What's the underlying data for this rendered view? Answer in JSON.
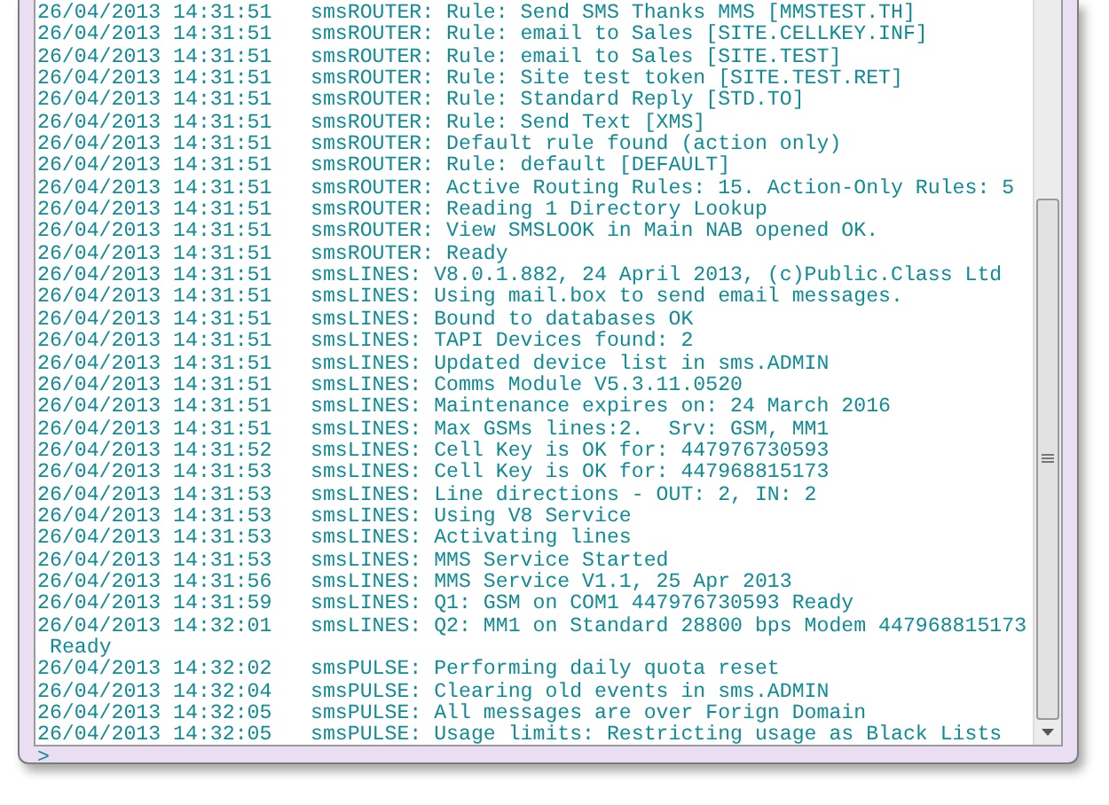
{
  "log": {
    "rows": [
      {
        "time": "26/04/2013 14:31:51",
        "message": "smsROUTER: Rule: Send SMS Thanks MMS [MMSTEST.TH]"
      },
      {
        "time": "26/04/2013 14:31:51",
        "message": "smsROUTER: Rule: email to Sales [SITE.CELLKEY.INF]"
      },
      {
        "time": "26/04/2013 14:31:51",
        "message": "smsROUTER: Rule: email to Sales [SITE.TEST]"
      },
      {
        "time": "26/04/2013 14:31:51",
        "message": "smsROUTER: Rule: Site test token [SITE.TEST.RET]"
      },
      {
        "time": "26/04/2013 14:31:51",
        "message": "smsROUTER: Rule: Standard Reply [STD.TO]"
      },
      {
        "time": "26/04/2013 14:31:51",
        "message": "smsROUTER: Rule: Send Text [XMS]"
      },
      {
        "time": "26/04/2013 14:31:51",
        "message": "smsROUTER: Default rule found (action only)"
      },
      {
        "time": "26/04/2013 14:31:51",
        "message": "smsROUTER: Rule: default [DEFAULT]"
      },
      {
        "time": "26/04/2013 14:31:51",
        "message": "smsROUTER: Active Routing Rules: 15. Action-Only Rules: 5"
      },
      {
        "time": "26/04/2013 14:31:51",
        "message": "smsROUTER: Reading 1 Directory Lookup"
      },
      {
        "time": "26/04/2013 14:31:51",
        "message": "smsROUTER: View SMSLOOK in Main NAB opened OK."
      },
      {
        "time": "26/04/2013 14:31:51",
        "message": "smsROUTER: Ready"
      },
      {
        "time": "26/04/2013 14:31:51",
        "message": "smsLINES: V8.0.1.882, 24 April 2013, (c)Public.Class Ltd"
      },
      {
        "time": "26/04/2013 14:31:51",
        "message": "smsLINES: Using mail.box to send email messages."
      },
      {
        "time": "26/04/2013 14:31:51",
        "message": "smsLINES: Bound to databases OK"
      },
      {
        "time": "26/04/2013 14:31:51",
        "message": "smsLINES: TAPI Devices found: 2"
      },
      {
        "time": "26/04/2013 14:31:51",
        "message": "smsLINES: Updated device list in sms.ADMIN"
      },
      {
        "time": "26/04/2013 14:31:51",
        "message": "smsLINES: Comms Module V5.3.11.0520"
      },
      {
        "time": "26/04/2013 14:31:51",
        "message": "smsLINES: Maintenance expires on: 24 March 2016"
      },
      {
        "time": "26/04/2013 14:31:51",
        "message": "smsLINES: Max GSMs lines:2.  Srv: GSM, MM1"
      },
      {
        "time": "26/04/2013 14:31:52",
        "message": "smsLINES: Cell Key is OK for: 447976730593"
      },
      {
        "time": "26/04/2013 14:31:53",
        "message": "smsLINES: Cell Key is OK for: 447968815173"
      },
      {
        "time": "26/04/2013 14:31:53",
        "message": "smsLINES: Line directions - OUT: 2, IN: 2"
      },
      {
        "time": "26/04/2013 14:31:53",
        "message": "smsLINES: Using V8 Service"
      },
      {
        "time": "26/04/2013 14:31:53",
        "message": "smsLINES: Activating lines"
      },
      {
        "time": "26/04/2013 14:31:53",
        "message": "smsLINES: MMS Service Started"
      },
      {
        "time": "26/04/2013 14:31:56",
        "message": "smsLINES: MMS Service V1.1, 25 Apr 2013"
      },
      {
        "time": "26/04/2013 14:31:59",
        "message": "smsLINES: Q1: GSM on COM1 447976730593 Ready"
      },
      {
        "time": "26/04/2013 14:32:01",
        "message": "smsLINES: Q2: MM1 on Standard 28800 bps Modem 447968815173",
        "continuation": "Ready"
      },
      {
        "time": "26/04/2013 14:32:02",
        "message": "smsPULSE: Performing daily quota reset"
      },
      {
        "time": "26/04/2013 14:32:04",
        "message": "smsPULSE: Clearing old events in sms.ADMIN"
      },
      {
        "time": "26/04/2013 14:32:05",
        "message": "smsPULSE: All messages are over Forign Domain"
      },
      {
        "time": "26/04/2013 14:32:05",
        "message": "smsPULSE: Usage limits: Restricting usage as Black Lists"
      }
    ],
    "prompt": ">"
  }
}
